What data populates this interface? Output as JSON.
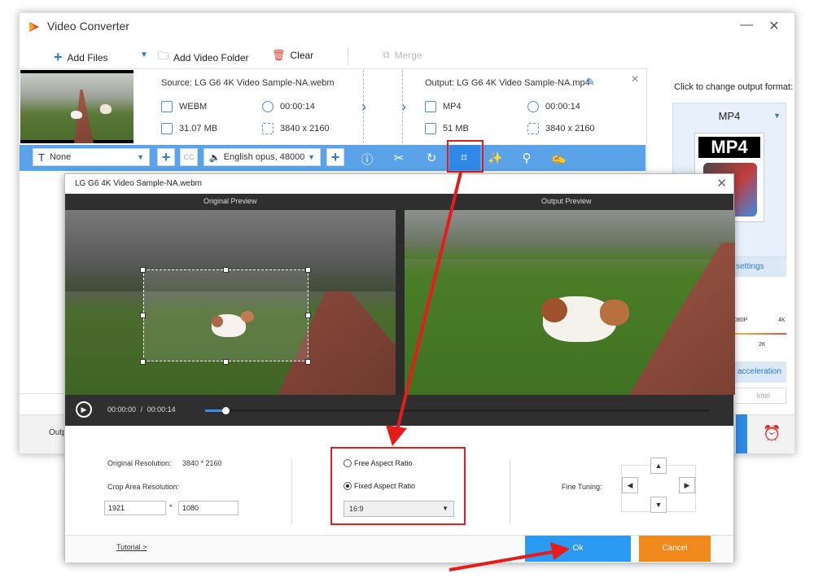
{
  "app": {
    "title": "Video Converter",
    "toolbar": {
      "add_files": "Add Files",
      "add_video_folder": "Add Video Folder",
      "clear": "Clear",
      "merge": "Merge"
    },
    "item": {
      "source": "Source: LG G6 4K Video Sample-NA.webm",
      "output": "Output: LG G6 4K Video Sample-NA.mp4",
      "src_format": "WEBM",
      "src_duration": "00:00:14",
      "src_size": "31.07 MB",
      "src_resolution": "3840 x 2160",
      "out_format": "MP4",
      "out_duration": "00:00:14",
      "out_size": "51 MB",
      "out_resolution": "3840 x 2160"
    },
    "editbar": {
      "subtitle": "None",
      "audio": "English opus, 48000"
    },
    "right": {
      "change_format": "Click to change output format:",
      "format": "MP4",
      "format_badge": "MP4",
      "settings": "r settings",
      "res_1080": "080P",
      "res_4k": "4K",
      "res_2k": "2K",
      "acceleration": "acceleration",
      "intel": "Intel"
    },
    "behind_output": "Outp"
  },
  "dialog": {
    "title": "LG G6 4K Video Sample-NA.webm",
    "original_preview": "Original Preview",
    "output_preview": "Output Preview",
    "time_current": "00:00:00",
    "time_sep": "/",
    "time_total": "00:00:14",
    "playback_progress_pct": 4,
    "original_resolution_label": "Original Resolution:",
    "original_resolution_value": "3840 * 2160",
    "crop_area_label": "Crop Area Resolution:",
    "crop_width": "1921",
    "crop_times": "*",
    "crop_height": "1080",
    "free_aspect": "Free Aspect Ratio",
    "fixed_aspect": "Fixed Aspect Ratio",
    "aspect_value": "16:9",
    "fine_tuning": "Fine Tuning:",
    "tutorial": "Tutorial >",
    "ok": "Ok",
    "cancel": "Cancel"
  },
  "colors": {
    "accent_blue": "#5ba3e8",
    "ok_blue": "#2b9af3",
    "cancel_orange": "#f08a1c",
    "highlight_red": "#e02020"
  }
}
